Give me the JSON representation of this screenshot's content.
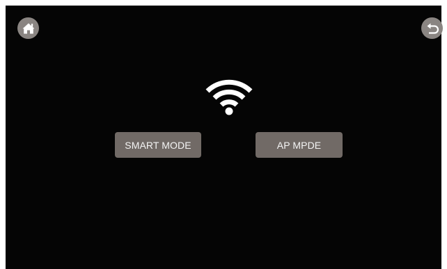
{
  "toolbar": {
    "home_icon": "home-icon",
    "back_icon": "back-arrow-icon"
  },
  "status": {
    "wifi_icon": "wifi-icon"
  },
  "modes": {
    "smart_label": "SMART MODE",
    "ap_label": "AP MPDE"
  },
  "colors": {
    "screen_background": "#050505",
    "button_background": "#716a66",
    "icon_button_background": "#8a8582",
    "icon_foreground": "#ffffff",
    "label_text": "#f4f4f4"
  }
}
